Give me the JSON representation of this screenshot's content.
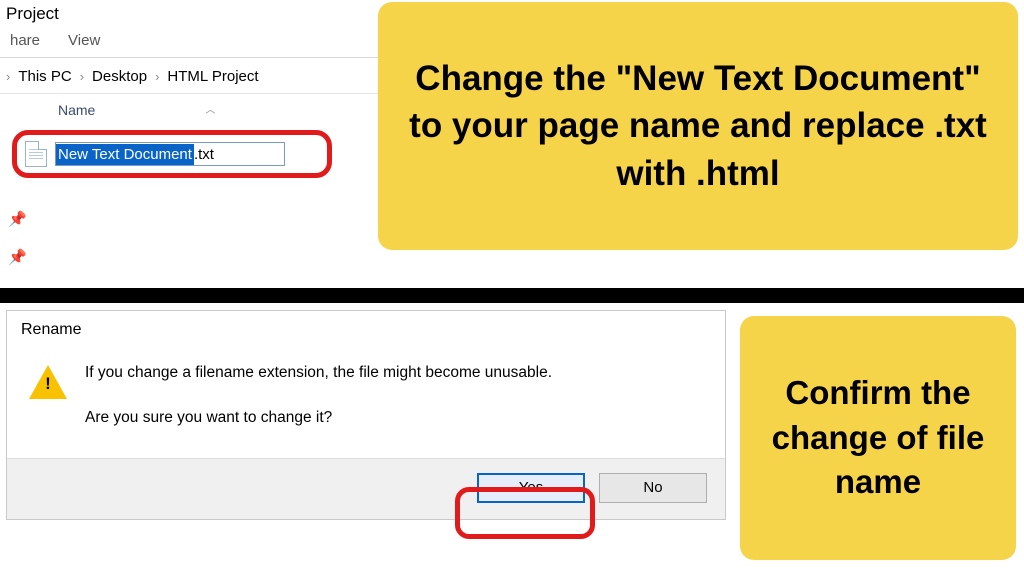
{
  "explorer": {
    "window_title": "Project",
    "ribbon_tabs": [
      "hare",
      "View"
    ],
    "breadcrumbs": [
      "This PC",
      "Desktop",
      "HTML Project"
    ],
    "column_header": "Name",
    "file": {
      "selected_name": "New Text Document",
      "extension": ".txt"
    }
  },
  "annotations": {
    "top": "Change the \"New Text Document\" to your page name and replace .txt with .html",
    "bottom": "Confirm the change of file name"
  },
  "dialog": {
    "title": "Rename",
    "message": "If you change a filename extension, the file might become unusable.",
    "question": "Are you sure you want to change it?",
    "yes_label": "Yes",
    "no_label": "No"
  }
}
